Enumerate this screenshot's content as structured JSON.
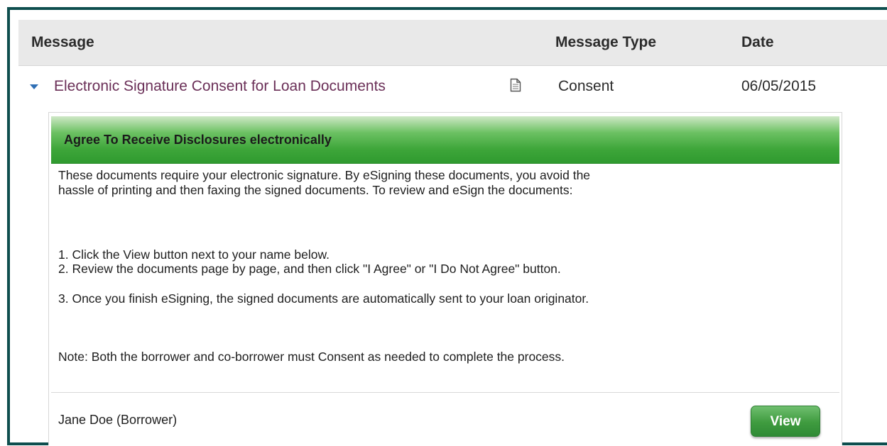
{
  "table": {
    "headers": {
      "message": "Message",
      "message_type": "Message Type",
      "date": "Date"
    },
    "row": {
      "message": "Electronic Signature Consent for Loan Documents",
      "message_type": "Consent",
      "date": "06/05/2015",
      "icon": "document-icon",
      "expand_icon": "caret-down-icon"
    }
  },
  "panel": {
    "title": "Agree To Receive Disclosures electronically",
    "intro": "These documents require your electronic signature. By eSigning these documents, you avoid the hassle of printing and then faxing the signed documents. To review and eSign the documents:",
    "steps": [
      "1. Click the View button next to your name below.",
      "2. Review the documents page by page, and then click \"I Agree\" or \"I Do Not Agree\" button.",
      "3. Once you finish eSigning, the signed documents are automatically sent to your loan originator."
    ],
    "note": "Note: Both the borrower and co-borrower must Consent as needed to complete the process.",
    "signer": "Jane Doe (Borrower)",
    "view_label": "View"
  },
  "colors": {
    "frame": "#0e4e4e",
    "link": "#6b3058",
    "header_bg": "#e9e9e9",
    "panel_green": "#3ea63a",
    "button_green": "#3f9b3f"
  }
}
